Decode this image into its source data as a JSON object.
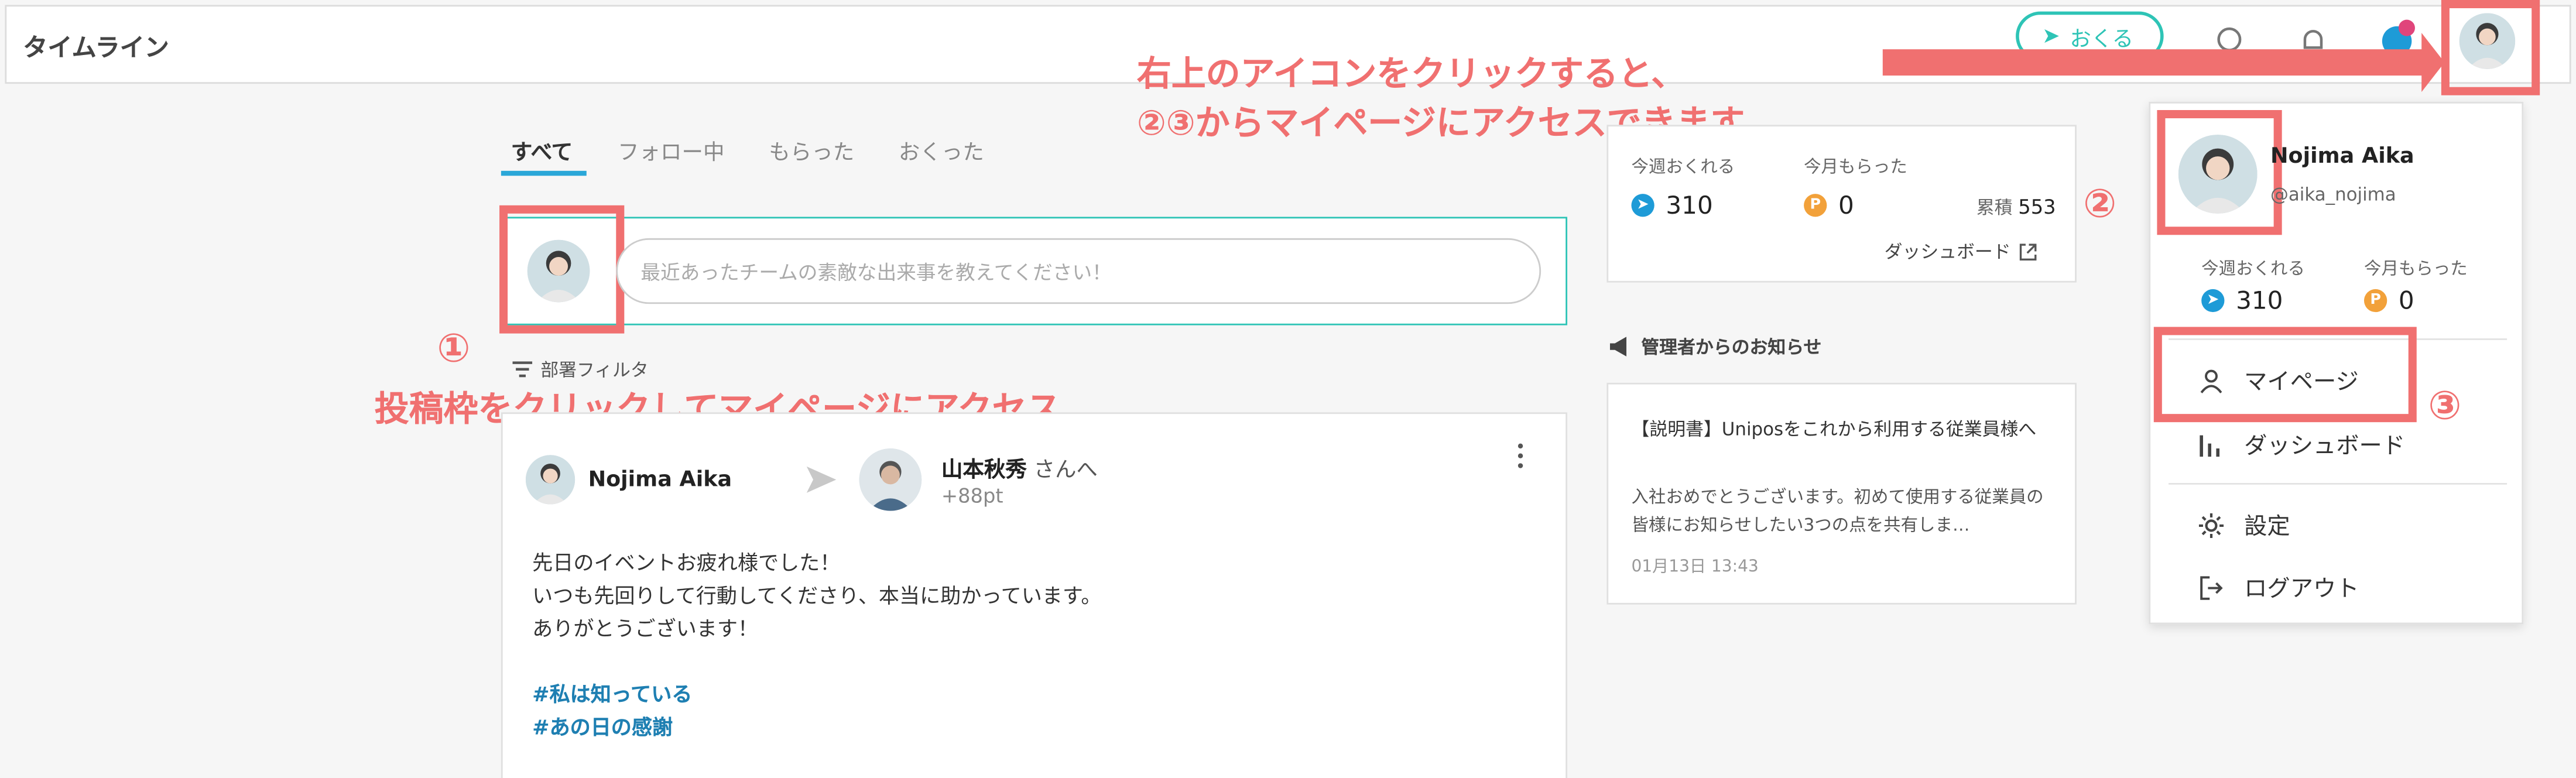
{
  "header": {
    "title": "タイムライン",
    "send_button": "おくる"
  },
  "annotations": {
    "top_line1": "右上のアイコンをクリックすると、",
    "top_line2": "②③からマイページにアクセスできます",
    "num1": "①",
    "num1_text": "投稿枠をクリックしてマイページにアクセス",
    "num2": "②",
    "num3": "③",
    "color": "#f07070"
  },
  "tabs": [
    {
      "label": "すべて",
      "active": true
    },
    {
      "label": "フォロー中",
      "active": false
    },
    {
      "label": "もらった",
      "active": false
    },
    {
      "label": "おくった",
      "active": false
    }
  ],
  "composer": {
    "placeholder": "最近あったチームの素敵な出来事を教えてください！"
  },
  "filter_label": "部署フィルタ",
  "post": {
    "sender": "Nojima Aika",
    "recipient": "山本秋秀",
    "recipient_suffix": "さんへ",
    "points": "+88pt",
    "body_lines": [
      "先日のイベントお疲れ様でした！",
      "いつも先回りして行動してくださり、本当に助かっています。",
      "ありがとうございます！"
    ],
    "hashtags": [
      "#私は知っている",
      "#あの日の感謝"
    ]
  },
  "stats": {
    "send_label": "今週おくれる",
    "send_value": "310",
    "recv_label": "今月もらった",
    "recv_value": "0",
    "total_label": "累積",
    "total_value": "553",
    "dashboard_link": "ダッシュボード"
  },
  "news": {
    "section_title": "管理者からのお知らせ",
    "item_title": "【説明書】Uniposをこれから利用する従業員様へ",
    "item_body": "入社おめでとうございます。初めて使用する従業員の皆様にお知らせしたい3つの点を共有しま…",
    "item_date": "01月13日 13:43"
  },
  "dropdown": {
    "name": "Nojima Aika",
    "handle": "@aika_nojima",
    "send_label": "今週おくれる",
    "send_value": "310",
    "recv_label": "今月もらった",
    "recv_value": "0",
    "items": [
      {
        "label": "マイページ",
        "icon": "user-icon"
      },
      {
        "label": "ダッシュボード",
        "icon": "bar-chart-icon"
      },
      {
        "label": "設定",
        "icon": "gear-icon"
      },
      {
        "label": "ログアウト",
        "icon": "logout-icon"
      }
    ]
  },
  "colors": {
    "accent_teal": "#2ec4b6",
    "tab_underline": "#2aa7d8",
    "hashtag": "#1e7fb2",
    "blue_badge": "#1e9bd7",
    "orange_badge": "#f2a13a"
  }
}
